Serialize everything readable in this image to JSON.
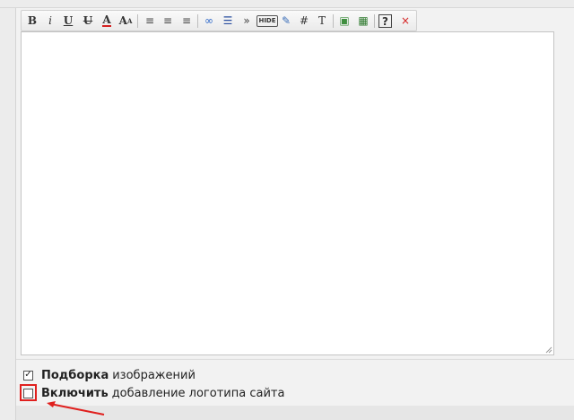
{
  "toolbar": {
    "buttons": [
      {
        "name": "bold-button",
        "glyph": "B",
        "bold": true,
        "serif": true,
        "color": "#333333"
      },
      {
        "name": "italic-button",
        "glyph": "i",
        "italic": true,
        "serif": true,
        "color": "#333333"
      },
      {
        "name": "underline-button",
        "glyph": "U",
        "underline": true,
        "bold": true,
        "serif": true,
        "color": "#333333"
      },
      {
        "name": "strikethrough-button",
        "glyph": "U",
        "strike": true,
        "bold": true,
        "serif": true,
        "color": "#333333"
      },
      {
        "name": "font-color-button",
        "glyph": "A",
        "bold": true,
        "serif": true,
        "color": "#333333",
        "underlineColor": "#d42020"
      },
      {
        "name": "font-size-button",
        "glyph": "A",
        "bold": true,
        "serif": true,
        "sup": "A",
        "color": "#333333"
      },
      {
        "name": "align-left-button",
        "glyph": "≡",
        "color": "#444444"
      },
      {
        "name": "align-center-button",
        "glyph": "≡",
        "color": "#444444"
      },
      {
        "name": "align-right-button",
        "glyph": "≡",
        "color": "#444444"
      },
      {
        "name": "link-button",
        "glyph": "∞",
        "color": "#2a66c8"
      },
      {
        "name": "list-button",
        "glyph": "☰",
        "color": "#2a4fa0"
      },
      {
        "name": "quote-button",
        "glyph": "»",
        "color": "#444444"
      },
      {
        "name": "hide-button",
        "glyph": "HIDE",
        "small": true,
        "color": "#333333"
      },
      {
        "name": "edit-button",
        "glyph": "✎",
        "color": "#3a6db8"
      },
      {
        "name": "hashtag-button",
        "glyph": "#",
        "color": "#333333"
      },
      {
        "name": "text-button",
        "glyph": "T",
        "serif": true,
        "color": "#333333"
      },
      {
        "name": "image-button",
        "glyph": "▣",
        "color": "#3f8f3f"
      },
      {
        "name": "video-button",
        "glyph": "▦",
        "color": "#2f7a2f"
      },
      {
        "name": "help-button",
        "glyph": "?",
        "boxed": true,
        "color": "#333333"
      },
      {
        "name": "close-button",
        "glyph": "×",
        "color": "#d42020"
      }
    ]
  },
  "options": [
    {
      "checked": true,
      "bold": "Подборка",
      "text": "изображений",
      "checkmark": "✓"
    },
    {
      "checked": false,
      "bold": "Включить",
      "text": "добавление логотипа сайта",
      "checkmark": ""
    }
  ],
  "colors": {
    "highlight": "#e0201e",
    "editor_bg": "#ffffff"
  }
}
